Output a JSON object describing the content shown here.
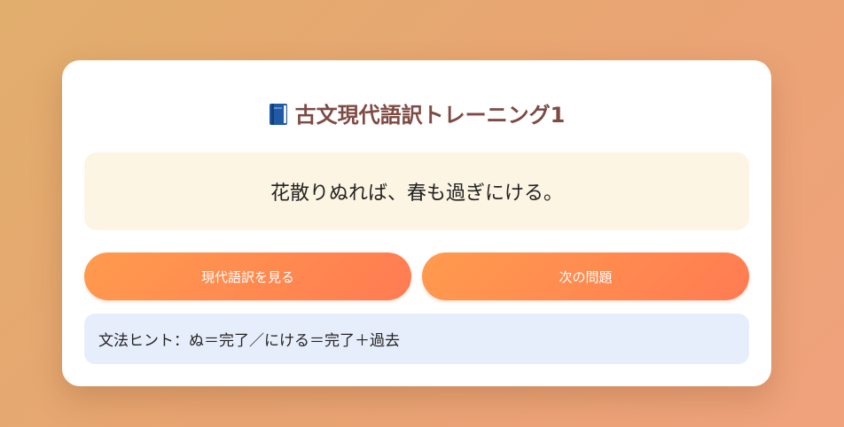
{
  "app": {
    "title": "古文現代語訳トレーニング1",
    "title_icon": "book-icon"
  },
  "question": {
    "sentence": "花散りぬれば、春も過ぎにける。"
  },
  "actions": {
    "show_translation_label": "現代語訳を見る",
    "next_question_label": "次の問題"
  },
  "hint": {
    "text": "文法ヒント：ぬ＝完了／にける＝完了＋過去"
  },
  "colors": {
    "title": "#7e4a43",
    "button_gradient_start": "#ff9b4e",
    "button_gradient_end": "#ff7b52",
    "sentence_bg": "#fdf5e4",
    "hint_bg": "#e7eefb"
  }
}
